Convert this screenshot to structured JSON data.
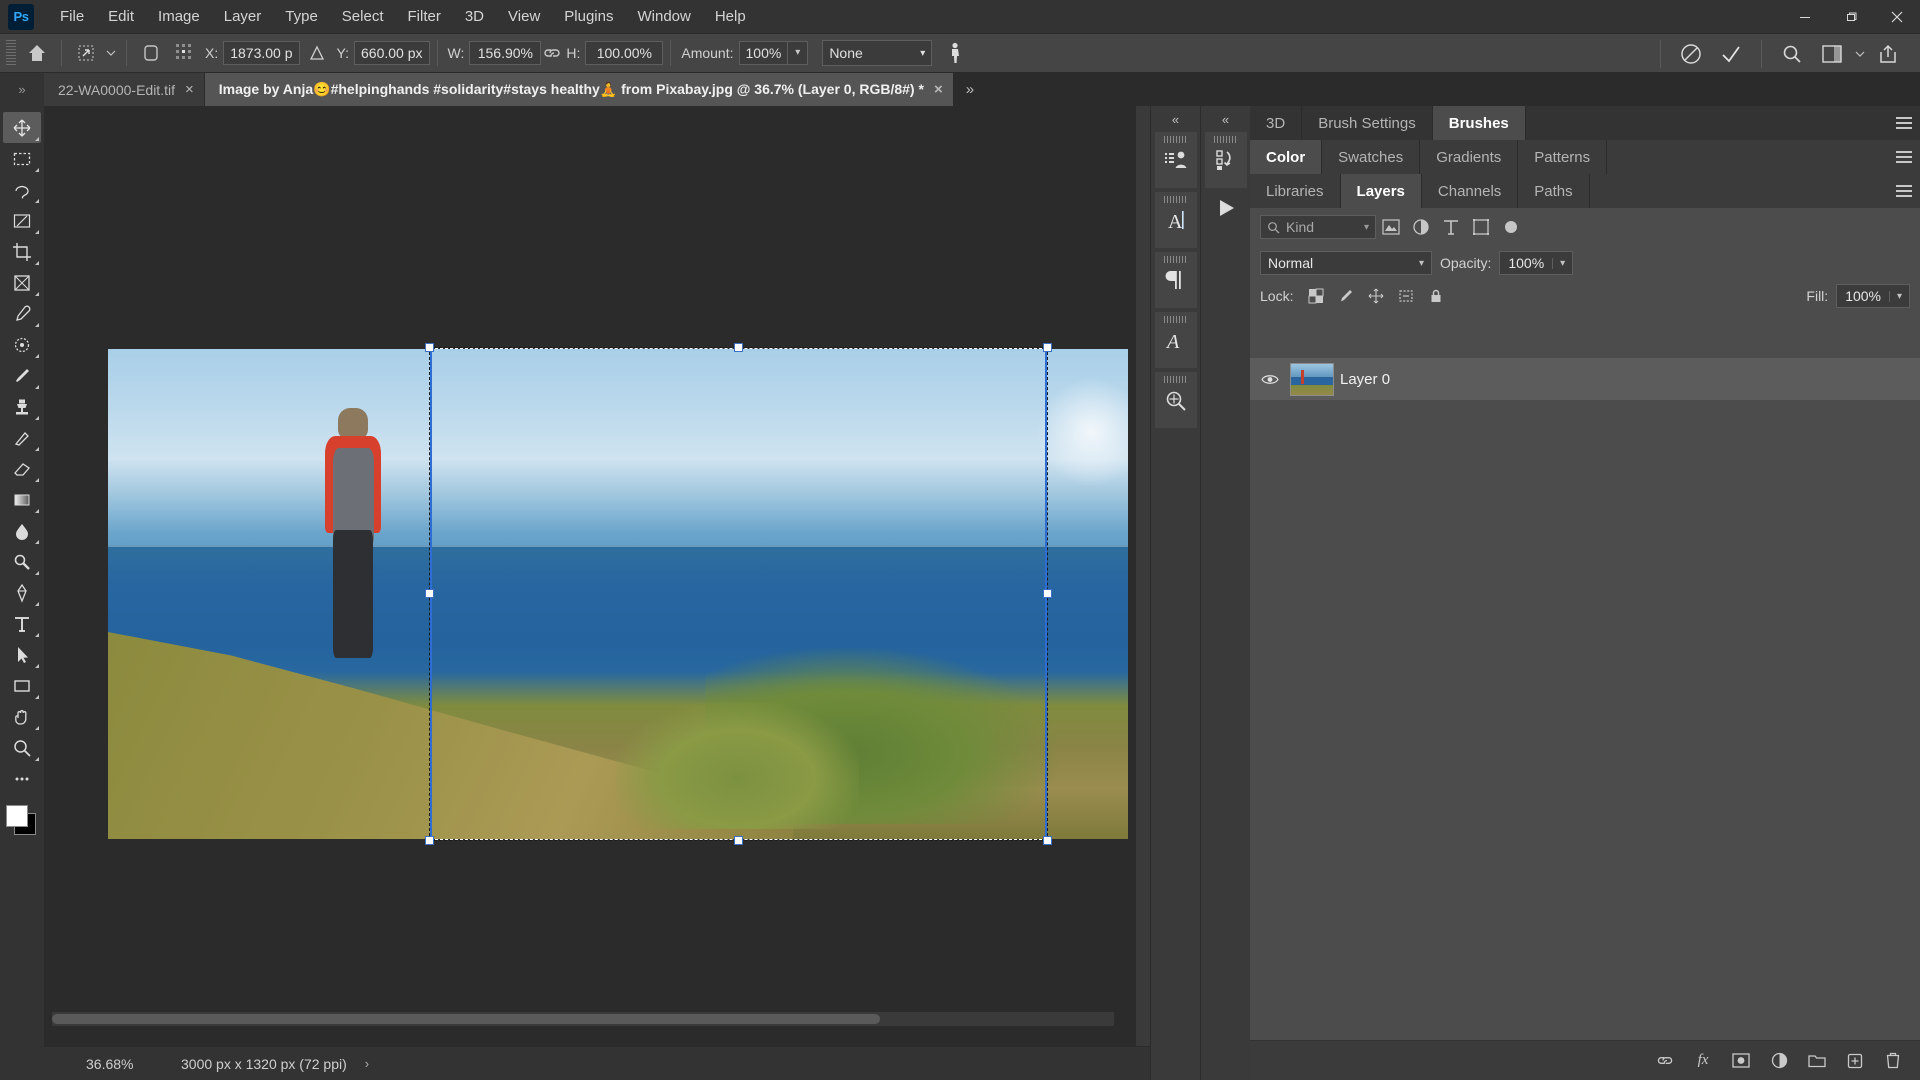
{
  "app": {
    "name": "Adobe Photoshop",
    "logo_text": "Ps",
    "accent": "#31a8ff",
    "chrome_bg": "#333333",
    "panel_bg": "#4c4c4c"
  },
  "menubar": {
    "items": [
      {
        "label": "File"
      },
      {
        "label": "Edit"
      },
      {
        "label": "Image"
      },
      {
        "label": "Layer"
      },
      {
        "label": "Type"
      },
      {
        "label": "Select"
      },
      {
        "label": "Filter"
      },
      {
        "label": "3D"
      },
      {
        "label": "View"
      },
      {
        "label": "Plugins"
      },
      {
        "label": "Window"
      },
      {
        "label": "Help"
      }
    ],
    "window_controls": [
      "minimize",
      "restore",
      "close"
    ]
  },
  "options_bar": {
    "home_icon": "home-icon",
    "tool_icon": "free-transform-icon",
    "reference_point_label": "reference-point-toggle",
    "x_label": "X:",
    "x_value": "1873.00 p",
    "delta_icon": "triangle-icon",
    "y_label": "Y:",
    "y_value": "660.00 px",
    "w_label": "W:",
    "w_value": "156.90%",
    "link_icon": "link-icon",
    "h_label": "H:",
    "h_value": "100.00%",
    "amount_label": "Amount:",
    "amount_value": "100%",
    "interpolation_value": "None",
    "puppet_icon": "puppet-warp-icon",
    "cancel_icon": "cancel-transform-icon",
    "commit_icon": "commit-transform-icon",
    "search_icon": "search-icon",
    "workspace_icon": "workspace-icon",
    "share_icon": "share-icon"
  },
  "tabs": {
    "overflow_left": "»",
    "overflow_right": "»",
    "items": [
      {
        "label": "22-WA0000-Edit.tif",
        "active": false,
        "close": "×"
      },
      {
        "label": "Image by Anja😊#helpinghands #solidarity#stays healthy🧘 from Pixabay.jpg @ 36.7% (Layer 0, RGB/8#) *",
        "active": true,
        "close": "×"
      }
    ]
  },
  "toolbar": {
    "items": [
      {
        "name": "move-tool",
        "glyph": "move"
      },
      {
        "name": "rectangular-marquee-tool",
        "glyph": "marquee"
      },
      {
        "name": "lasso-tool",
        "glyph": "lasso"
      },
      {
        "name": "object-selection-tool",
        "glyph": "quickselect"
      },
      {
        "name": "crop-tool",
        "glyph": "crop"
      },
      {
        "name": "frame-tool",
        "glyph": "frame"
      },
      {
        "name": "eyedropper-tool",
        "glyph": "eyedropper"
      },
      {
        "name": "spot-healing-brush-tool",
        "glyph": "healing"
      },
      {
        "name": "brush-tool",
        "glyph": "brush"
      },
      {
        "name": "clone-stamp-tool",
        "glyph": "stamp"
      },
      {
        "name": "history-brush-tool",
        "glyph": "historybrush"
      },
      {
        "name": "eraser-tool",
        "glyph": "eraser"
      },
      {
        "name": "gradient-tool",
        "glyph": "gradient"
      },
      {
        "name": "blur-tool",
        "glyph": "blur"
      },
      {
        "name": "dodge-tool",
        "glyph": "dodge"
      },
      {
        "name": "pen-tool",
        "glyph": "pen"
      },
      {
        "name": "horizontal-type-tool",
        "glyph": "type"
      },
      {
        "name": "path-selection-tool",
        "glyph": "pathselect"
      },
      {
        "name": "rectangle-tool",
        "glyph": "rectangle"
      },
      {
        "name": "hand-tool",
        "glyph": "hand"
      },
      {
        "name": "zoom-tool",
        "glyph": "zoom"
      },
      {
        "name": "edit-toolbar",
        "glyph": "ellipsis"
      }
    ],
    "foreground_color": "#ffffff",
    "background_color": "#000000"
  },
  "canvas": {
    "document_scale_label": "36.68%",
    "document_dimensions": "3000 px x 1320 px (72 ppi)",
    "status_arrow": "›",
    "transform": {
      "selection_active": true,
      "handles": 8
    }
  },
  "mini_docks": {
    "dock1": {
      "collapse": "«",
      "buttons": [
        "adjustments-icon",
        "character-icon",
        "paragraph-icon",
        "glyphs-icon",
        "histogram-icon"
      ]
    },
    "dock2": {
      "collapse": "«",
      "buttons": [
        "history-icon",
        "actions-play-icon"
      ]
    }
  },
  "panels": {
    "group1": {
      "tabs": [
        {
          "label": "3D",
          "active": false
        },
        {
          "label": "Brush Settings",
          "active": false
        },
        {
          "label": "Brushes",
          "active": true
        }
      ],
      "menu_icon": "panel-menu-icon"
    },
    "group2": {
      "tabs": [
        {
          "label": "Color",
          "active": true
        },
        {
          "label": "Swatches",
          "active": false
        },
        {
          "label": "Gradients",
          "active": false
        },
        {
          "label": "Patterns",
          "active": false
        }
      ],
      "menu_icon": "panel-menu-icon"
    },
    "group3": {
      "tabs": [
        {
          "label": "Libraries",
          "active": false
        },
        {
          "label": "Layers",
          "active": true
        },
        {
          "label": "Channels",
          "active": false
        },
        {
          "label": "Paths",
          "active": false
        }
      ],
      "menu_icon": "panel-menu-icon"
    }
  },
  "layers_panel": {
    "filter": {
      "search_icon": "search-icon",
      "kind_label": "Kind",
      "chevron": "⌄",
      "filter_icons": [
        "pixel-filter-icon",
        "adjustment-filter-icon",
        "type-filter-icon",
        "shape-filter-icon",
        "smart-object-filter-icon"
      ],
      "toggle_icon": "filter-toggle-icon"
    },
    "blend_mode": "Normal",
    "blend_chevron": "⌄",
    "opacity_label": "Opacity:",
    "opacity_value": "100%",
    "lock_label": "Lock:",
    "lock_icons": [
      "lock-transparent-pixels-icon",
      "lock-image-pixels-icon",
      "lock-position-icon",
      "lock-artboard-icon",
      "lock-all-icon"
    ],
    "fill_label": "Fill:",
    "fill_value": "100%",
    "layers": [
      {
        "visible": true,
        "eye_icon": "eye-icon",
        "thumbnail": "layer-thumbnail",
        "name": "Layer 0",
        "selected": true
      }
    ],
    "footer_buttons": [
      {
        "name": "link-layers-button",
        "glyph": "link"
      },
      {
        "name": "layer-style-button",
        "glyph": "fx"
      },
      {
        "name": "layer-mask-button",
        "glyph": "mask"
      },
      {
        "name": "adjustment-layer-button",
        "glyph": "adjust"
      },
      {
        "name": "new-group-button",
        "glyph": "folder"
      },
      {
        "name": "new-layer-button",
        "glyph": "newlayer"
      },
      {
        "name": "delete-layer-button",
        "glyph": "trash"
      }
    ]
  }
}
